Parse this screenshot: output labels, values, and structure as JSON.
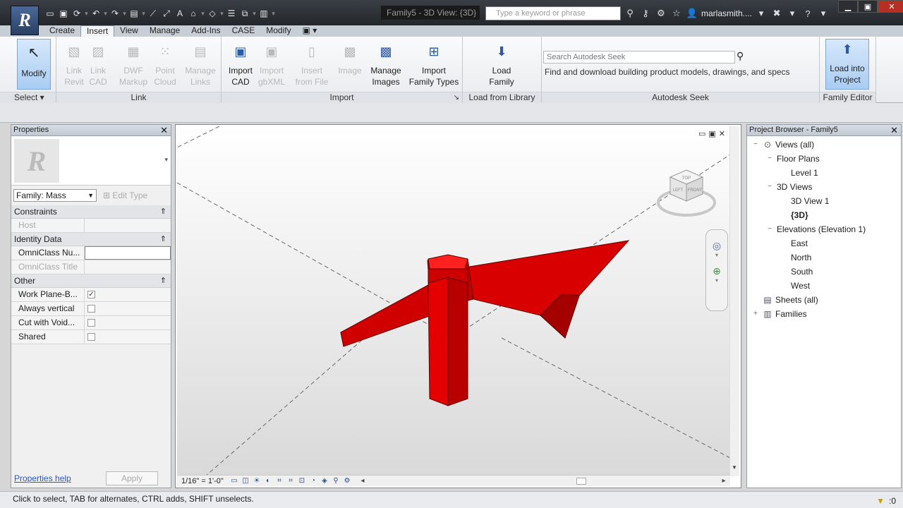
{
  "window": {
    "document_title": "Family5 - 3D View: {3D}",
    "app_letter": "R",
    "search_placeholder": "Type a keyword or phrase",
    "user_name": "marlasmith....",
    "min": "▁",
    "max": "▣",
    "close": "✕"
  },
  "tabs": [
    "Create",
    "Insert",
    "View",
    "Manage",
    "Add-Ins",
    "CASE",
    "Modify",
    "▣ ▾"
  ],
  "active_tab": "Insert",
  "ribbon": {
    "select": {
      "button": "Modify",
      "title": "Select ▾"
    },
    "link": {
      "title": "Link",
      "buttons": [
        {
          "l1": "Link",
          "l2": "Revit"
        },
        {
          "l1": "Link",
          "l2": "CAD"
        },
        {
          "l1": "DWF",
          "l2": "Markup"
        },
        {
          "l1": "Point",
          "l2": "Cloud"
        },
        {
          "l1": "Manage",
          "l2": "Links"
        }
      ]
    },
    "import": {
      "title": "Import",
      "buttons": [
        {
          "l1": "Import",
          "l2": "CAD",
          "enabled": true
        },
        {
          "l1": "Import",
          "l2": "gbXML",
          "enabled": false
        },
        {
          "l1": "Insert",
          "l2": "from File",
          "enabled": false
        },
        {
          "l1": "Image",
          "l2": "",
          "enabled": false
        },
        {
          "l1": "Manage",
          "l2": "Images",
          "enabled": true
        },
        {
          "l1": "Import",
          "l2": "Family Types",
          "enabled": true
        }
      ],
      "launcher": "↘"
    },
    "load_library": {
      "title": "Load from Library",
      "l1": "Load",
      "l2": "Family"
    },
    "seek": {
      "title": "Autodesk Seek",
      "placeholder": "Search Autodesk Seek",
      "description": "Find and download building product models, drawings, and specs"
    },
    "family_editor": {
      "title": "Family Editor",
      "l1": "Load into",
      "l2": "Project"
    }
  },
  "properties": {
    "title": "Properties",
    "family_selector": "Family: Mass",
    "edit_type": "Edit Type",
    "groups": [
      {
        "name": "Constraints",
        "rows": [
          {
            "label": "Host",
            "value": "",
            "disabled": true,
            "type": "text"
          }
        ]
      },
      {
        "name": "Identity Data",
        "rows": [
          {
            "label": "OmniClass Nu...",
            "value": "",
            "disabled": false,
            "type": "input"
          },
          {
            "label": "OmniClass Title",
            "value": "",
            "disabled": true,
            "type": "text"
          }
        ]
      },
      {
        "name": "Other",
        "rows": [
          {
            "label": "Work Plane-B...",
            "checked": true,
            "type": "check"
          },
          {
            "label": "Always vertical",
            "checked": false,
            "type": "check"
          },
          {
            "label": "Cut with Void...",
            "checked": false,
            "type": "check"
          },
          {
            "label": "Shared",
            "checked": false,
            "type": "check"
          }
        ]
      }
    ],
    "help": "Properties help",
    "apply": "Apply"
  },
  "viewport": {
    "scale": "1/16\" = 1'-0\"",
    "viewcube_faces": [
      "TOP",
      "LEFT",
      "FRONT"
    ],
    "controls": [
      "▭",
      "▣",
      "✕"
    ],
    "model_color": "#e00000"
  },
  "browser": {
    "title": "Project Browser - Family5",
    "tree": [
      {
        "label": "Views (all)",
        "level": 0,
        "toggle": "−",
        "icon": "views"
      },
      {
        "label": "Floor Plans",
        "level": 1,
        "toggle": "−",
        "icon": ""
      },
      {
        "label": "Level 1",
        "level": 2,
        "toggle": "",
        "icon": ""
      },
      {
        "label": "3D Views",
        "level": 1,
        "toggle": "−",
        "icon": ""
      },
      {
        "label": "3D View 1",
        "level": 2,
        "toggle": "",
        "icon": ""
      },
      {
        "label": "{3D}",
        "level": 2,
        "toggle": "",
        "icon": "",
        "bold": true
      },
      {
        "label": "Elevations (Elevation 1)",
        "level": 1,
        "toggle": "−",
        "icon": ""
      },
      {
        "label": "East",
        "level": 2,
        "toggle": "",
        "icon": ""
      },
      {
        "label": "North",
        "level": 2,
        "toggle": "",
        "icon": ""
      },
      {
        "label": "South",
        "level": 2,
        "toggle": "",
        "icon": ""
      },
      {
        "label": "West",
        "level": 2,
        "toggle": "",
        "icon": ""
      },
      {
        "label": "Sheets (all)",
        "level": 0,
        "toggle": "",
        "icon": "sheets"
      },
      {
        "label": "Families",
        "level": 0,
        "toggle": "+",
        "icon": "families"
      }
    ]
  },
  "status": {
    "text": "Click to select, TAB for alternates, CTRL adds, SHIFT unselects.",
    "filter_count": ":0"
  }
}
